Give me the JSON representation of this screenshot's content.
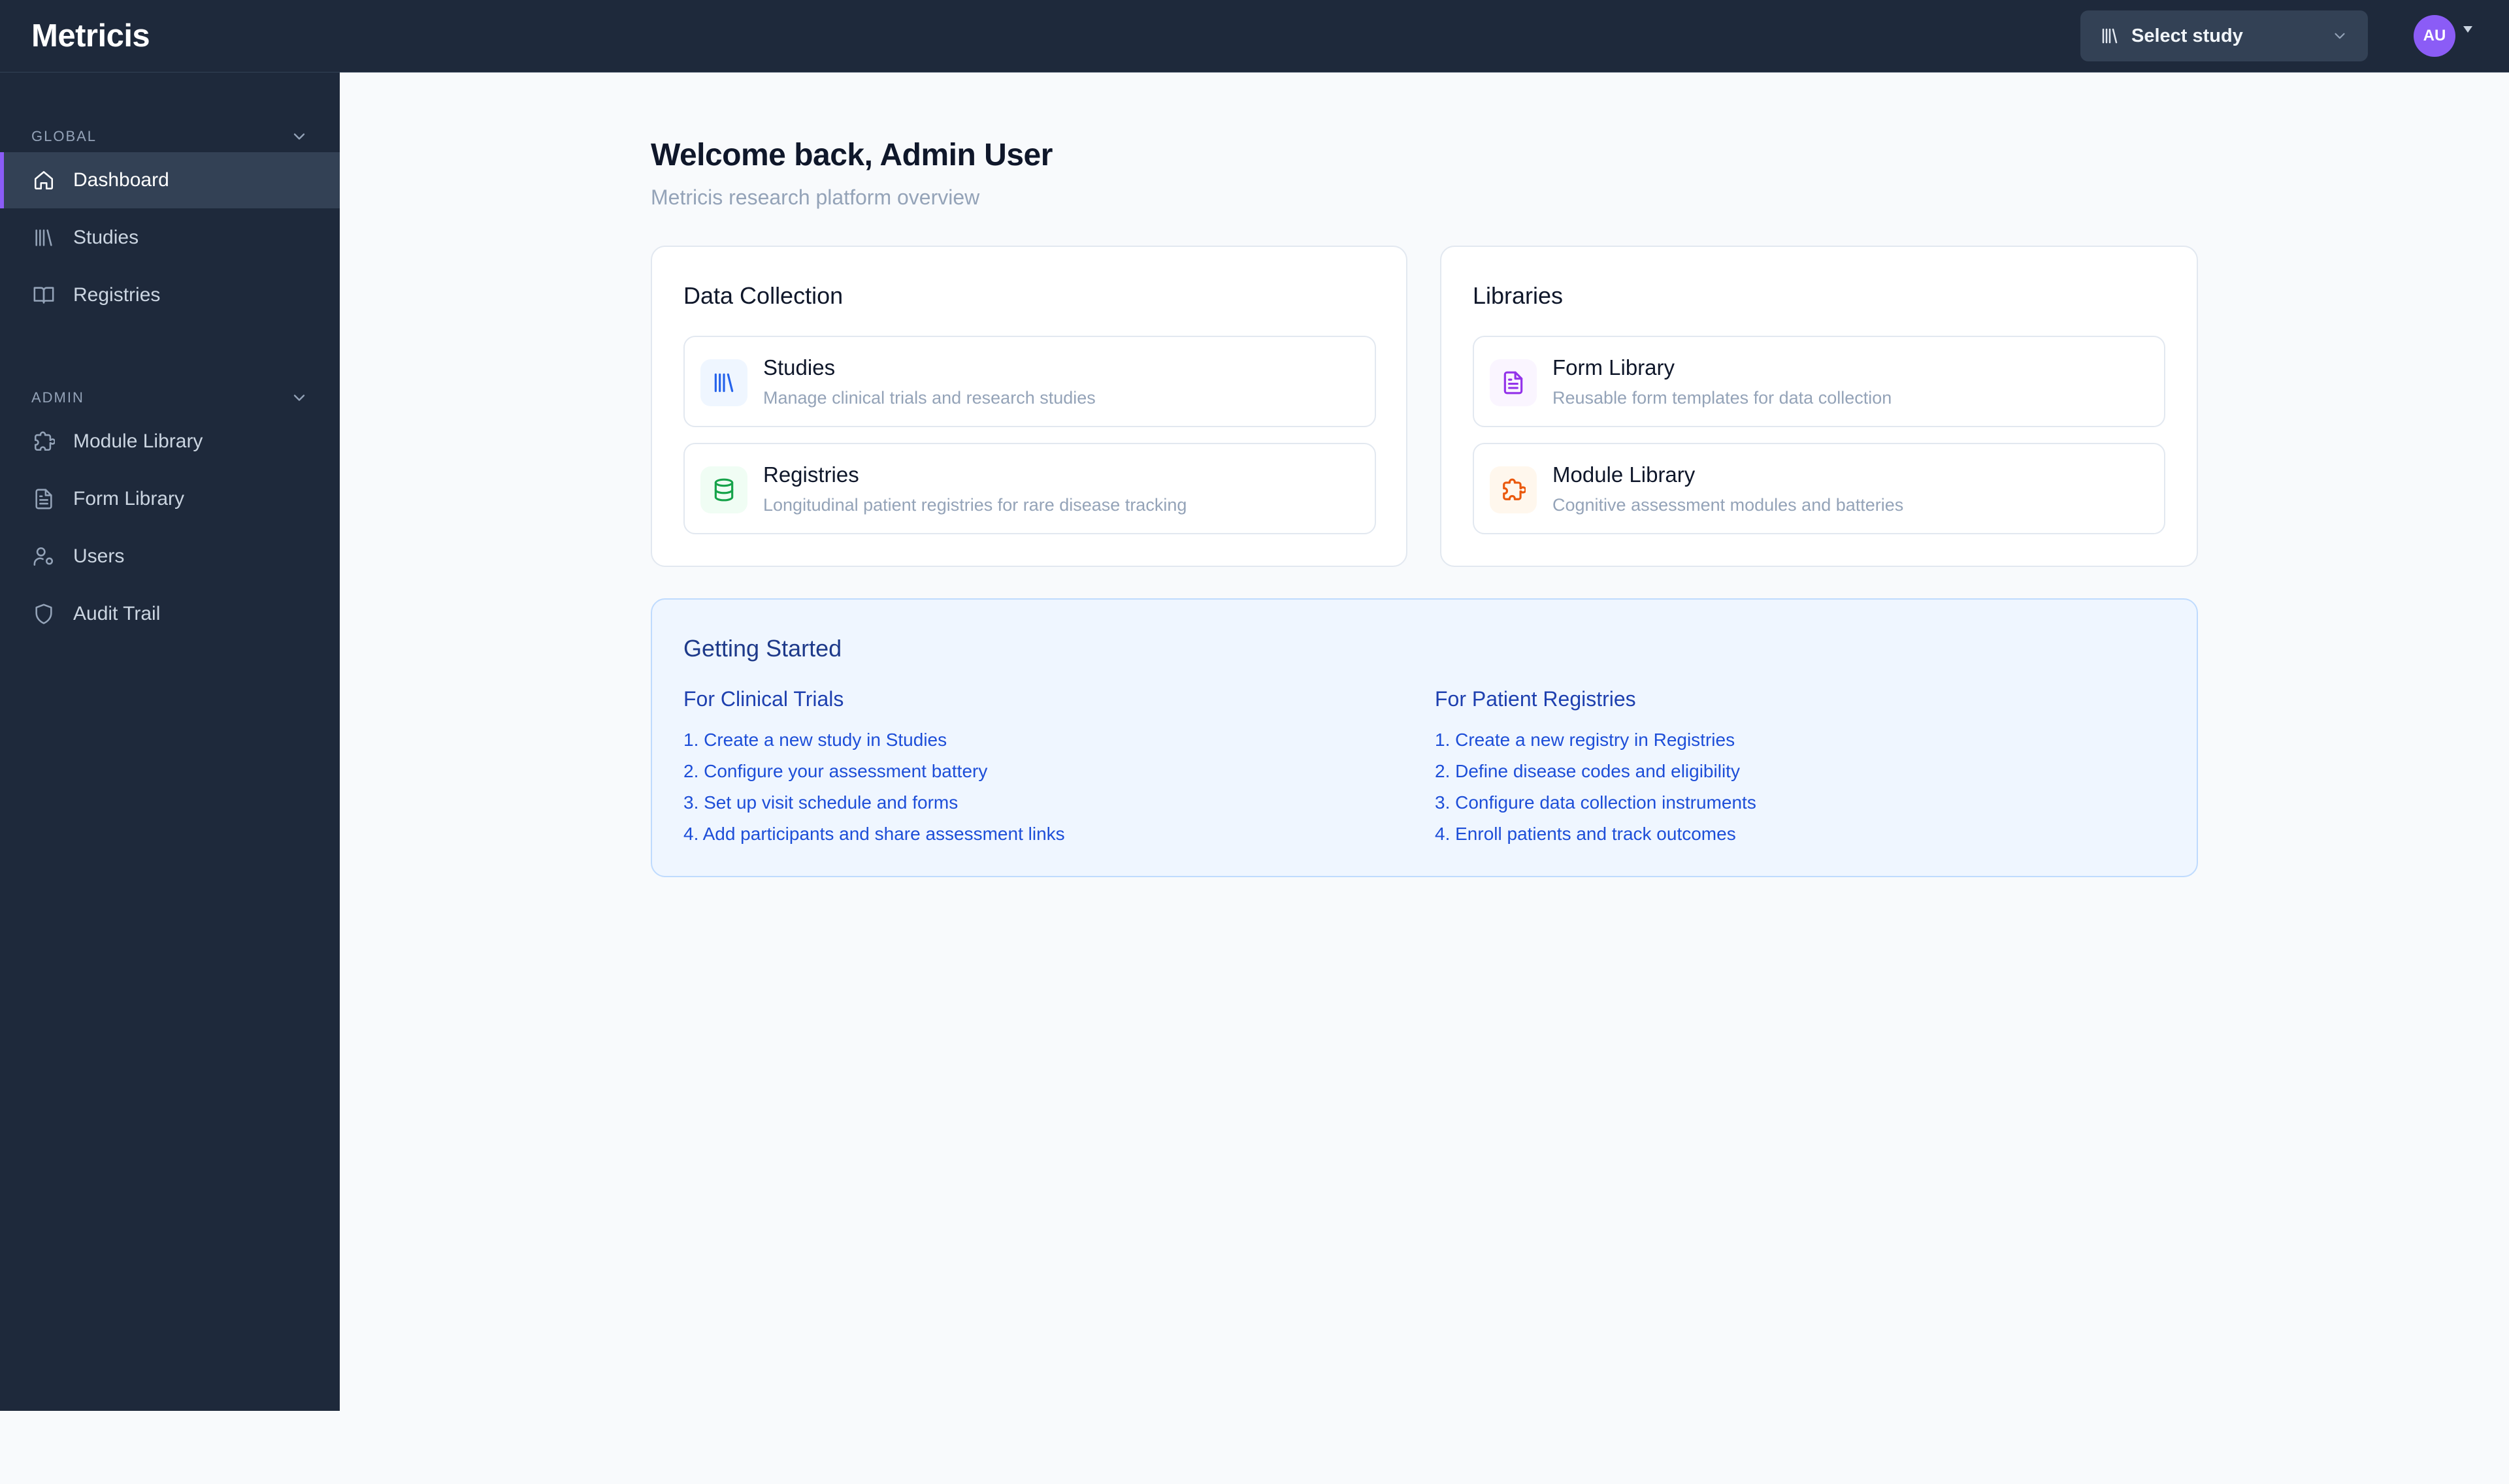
{
  "app": {
    "brand": "Metricis"
  },
  "header": {
    "study_select_label": "Select study",
    "avatar_initials": "AU"
  },
  "sidebar": {
    "sections": [
      {
        "label": "GLOBAL",
        "items": [
          {
            "label": "Dashboard",
            "icon": "home-icon",
            "active": true
          },
          {
            "label": "Studies",
            "icon": "library-icon"
          },
          {
            "label": "Registries",
            "icon": "book-open-icon"
          }
        ]
      },
      {
        "label": "ADMIN",
        "items": [
          {
            "label": "Module Library",
            "icon": "puzzle-icon"
          },
          {
            "label": "Form Library",
            "icon": "file-text-icon"
          },
          {
            "label": "Users",
            "icon": "user-cog-icon"
          },
          {
            "label": "Audit Trail",
            "icon": "shield-icon"
          }
        ]
      }
    ]
  },
  "main": {
    "welcome": "Welcome back, Admin User",
    "subtitle": "Metricis research platform overview",
    "cards": [
      {
        "title": "Data Collection",
        "tiles": [
          {
            "title": "Studies",
            "description": "Manage clinical trials and research studies",
            "icon": "library-icon",
            "color": "#2563eb"
          },
          {
            "title": "Registries",
            "description": "Longitudinal patient registries for rare disease tracking",
            "icon": "database-icon",
            "color": "#16a34a"
          }
        ]
      },
      {
        "title": "Libraries",
        "tiles": [
          {
            "title": "Form Library",
            "description": "Reusable form templates for data collection",
            "icon": "file-text-icon",
            "color": "#9333ea"
          },
          {
            "title": "Module Library",
            "description": "Cognitive assessment modules and batteries",
            "icon": "puzzle-icon",
            "color": "#ea580c"
          }
        ]
      }
    ],
    "getting_started": {
      "title": "Getting Started",
      "columns": [
        {
          "title": "For Clinical Trials",
          "steps": [
            "1. Create a new study in Studies",
            "2. Configure your assessment battery",
            "3. Set up visit schedule and forms",
            "4. Add participants and share assessment links"
          ]
        },
        {
          "title": "For Patient Registries",
          "steps": [
            "1. Create a new registry in Registries",
            "2. Define disease codes and eligibility",
            "3. Configure data collection instruments",
            "4. Enroll patients and track outcomes"
          ]
        }
      ]
    }
  },
  "colors": {
    "sidebar_bg": "#1e293b",
    "accent": "#8b5cf6",
    "page_bg": "#f8fafc"
  }
}
